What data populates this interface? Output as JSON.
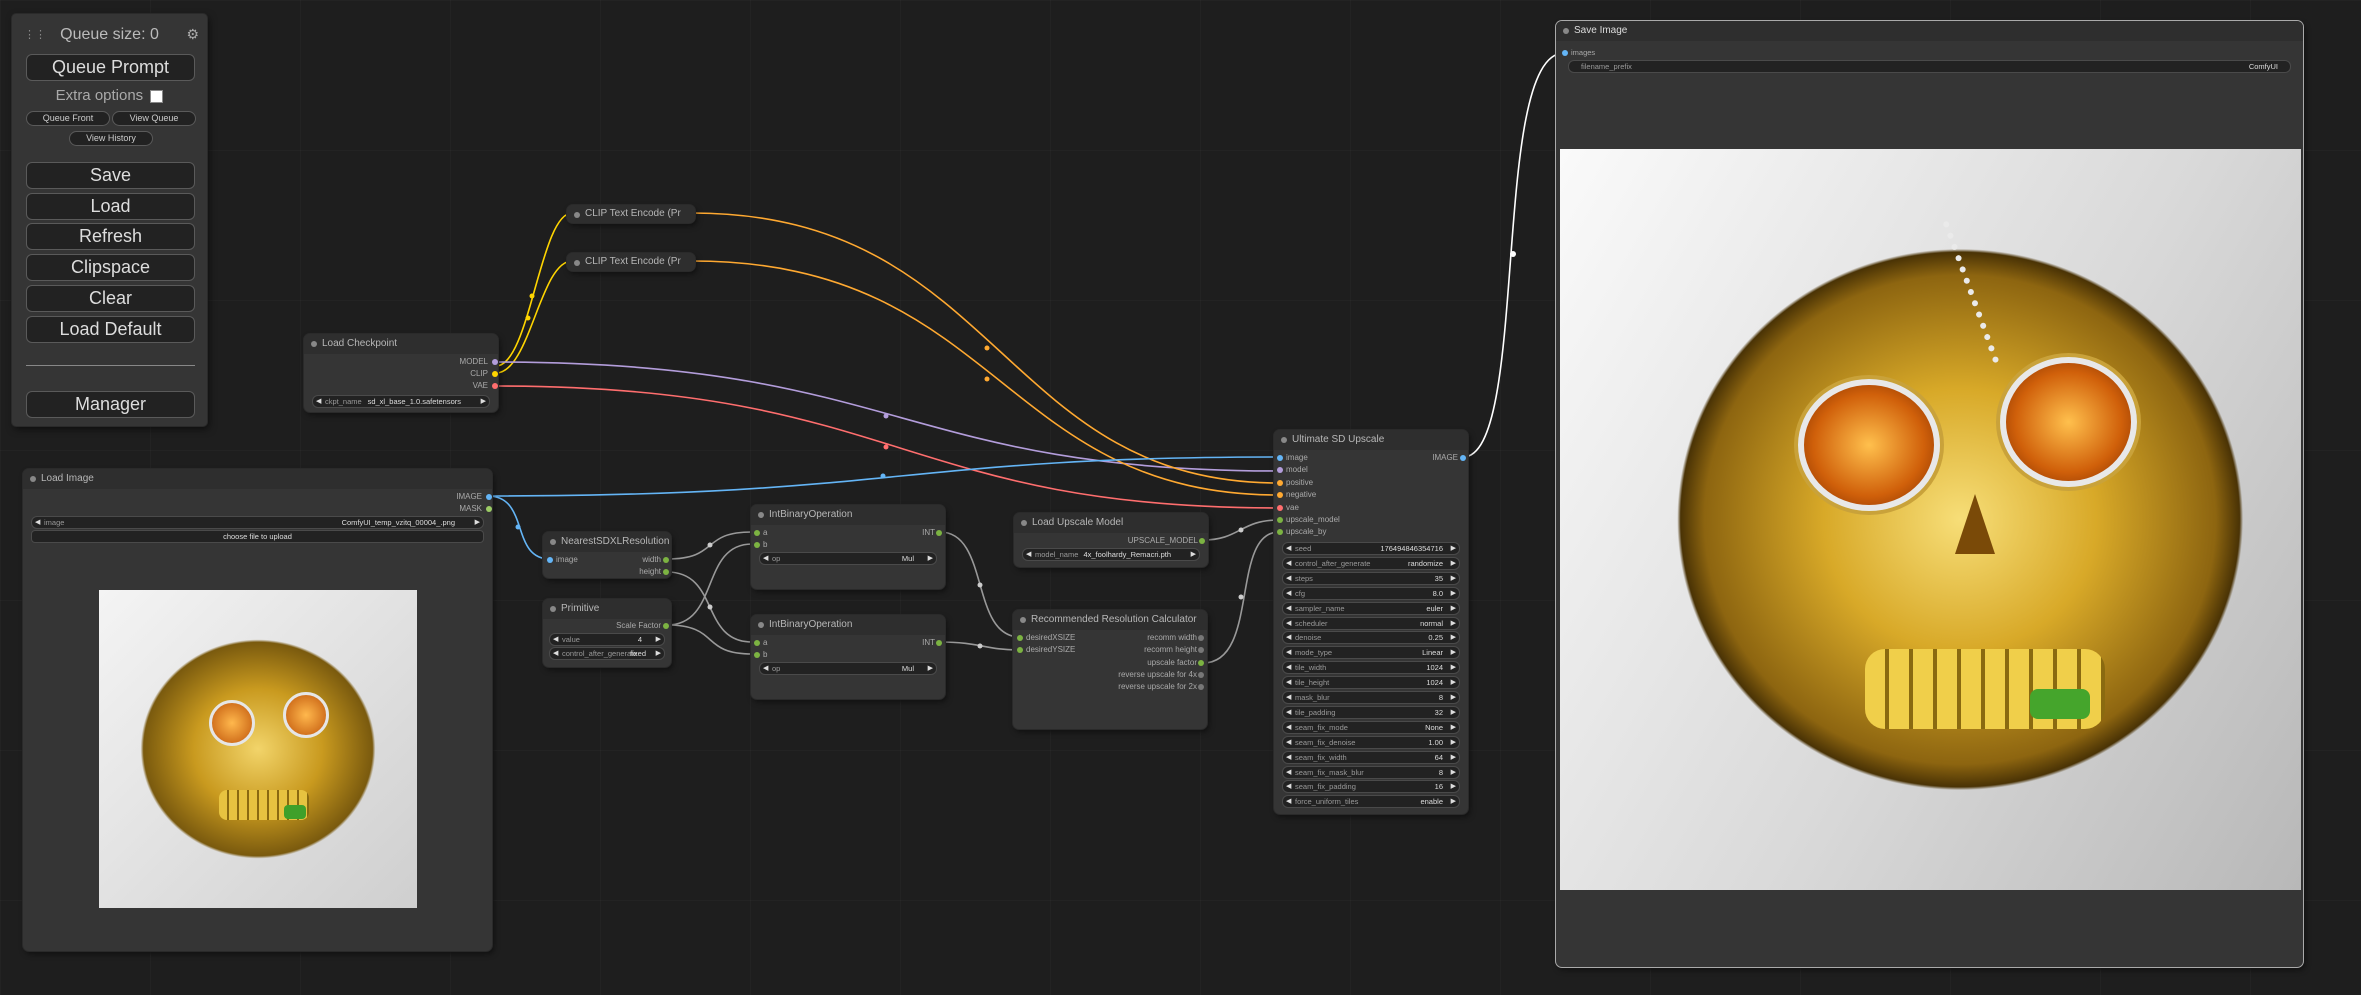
{
  "menu": {
    "queue_size": "Queue size: 0",
    "queue_prompt": "Queue Prompt",
    "extra_options": "Extra options",
    "queue_front": "Queue Front",
    "view_queue": "View Queue",
    "view_history": "View History",
    "save": "Save",
    "load": "Load",
    "refresh": "Refresh",
    "clipspace": "Clipspace",
    "clear": "Clear",
    "load_default": "Load Default",
    "manager": "Manager"
  },
  "nodes": {
    "clip1": {
      "title": "CLIP Text Encode (Pr"
    },
    "clip2": {
      "title": "CLIP Text Encode (Pr"
    },
    "checkpoint": {
      "title": "Load Checkpoint",
      "out_model": "MODEL",
      "out_clip": "CLIP",
      "out_vae": "VAE",
      "w_label": "ckpt_name",
      "w_value": "sd_xl_base_1.0.safetensors"
    },
    "loadimage": {
      "title": "Load Image",
      "out_image": "IMAGE",
      "out_mask": "MASK",
      "w_label": "image",
      "w_value": "ComfyUI_temp_vzitq_00004_.png",
      "upload": "choose file to upload"
    },
    "nearest": {
      "title": "NearestSDXLResolution",
      "in_image": "image",
      "out_width": "width",
      "out_height": "height"
    },
    "primitive": {
      "title": "Primitive",
      "out": "Scale Factor",
      "w1_label": "value",
      "w1_value": "4",
      "w2_label": "control_after_generate",
      "w2_value": "fixed"
    },
    "intop1": {
      "title": "IntBinaryOperation",
      "in_a": "a",
      "in_b": "b",
      "out": "INT",
      "w_label": "op",
      "w_value": "Mul"
    },
    "intop2": {
      "title": "IntBinaryOperation",
      "in_a": "a",
      "in_b": "b",
      "out": "INT",
      "w_label": "op",
      "w_value": "Mul"
    },
    "upscalemodel": {
      "title": "Load Upscale Model",
      "out": "UPSCALE_MODEL",
      "w_label": "model_name",
      "w_value": "4x_foolhardy_Remacri.pth"
    },
    "recres": {
      "title": "Recommended Resolution Calculator",
      "in1": "desiredXSIZE",
      "in2": "desiredYSIZE",
      "outs": [
        "recomm width",
        "recomm height",
        "upscale factor",
        "reverse upscale for 4x",
        "reverse upscale for 2x"
      ]
    },
    "ultimate": {
      "title": "Ultimate SD Upscale",
      "inputs": [
        "image",
        "model",
        "positive",
        "negative",
        "vae",
        "upscale_model",
        "upscale_by"
      ],
      "out": "IMAGE",
      "widgets": [
        {
          "label": "seed",
          "value": "176494846354716"
        },
        {
          "label": "control_after_generate",
          "value": "randomize"
        },
        {
          "label": "steps",
          "value": "35"
        },
        {
          "label": "cfg",
          "value": "8.0"
        },
        {
          "label": "sampler_name",
          "value": "euler"
        },
        {
          "label": "scheduler",
          "value": "normal"
        },
        {
          "label": "denoise",
          "value": "0.25"
        },
        {
          "label": "mode_type",
          "value": "Linear"
        },
        {
          "label": "tile_width",
          "value": "1024"
        },
        {
          "label": "tile_height",
          "value": "1024"
        },
        {
          "label": "mask_blur",
          "value": "8"
        },
        {
          "label": "tile_padding",
          "value": "32"
        },
        {
          "label": "seam_fix_mode",
          "value": "None"
        },
        {
          "label": "seam_fix_denoise",
          "value": "1.00"
        },
        {
          "label": "seam_fix_width",
          "value": "64"
        },
        {
          "label": "seam_fix_mask_blur",
          "value": "8"
        },
        {
          "label": "seam_fix_padding",
          "value": "16"
        },
        {
          "label": "force_uniform_tiles",
          "value": "enable"
        }
      ]
    },
    "saveimage": {
      "title": "Save Image",
      "in": "images",
      "w_label": "filename_prefix",
      "w_value": "ComfyUI"
    }
  },
  "colors": {
    "model": "#b39ddb",
    "clip": "#ffd500",
    "vae": "#ff6e6e",
    "image": "#64b5f6",
    "int": "#7cb342",
    "generic": "#999999",
    "conditioning": "#ffa931"
  }
}
